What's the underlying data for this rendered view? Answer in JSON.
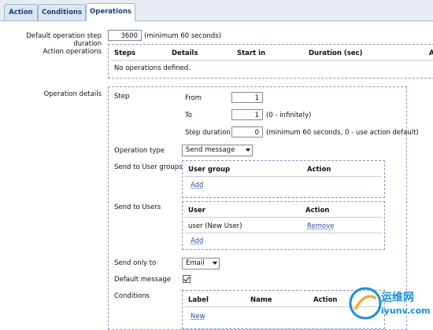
{
  "tabs": [
    {
      "label": "Action"
    },
    {
      "label": "Conditions"
    },
    {
      "label": "Operations"
    }
  ],
  "default_step": {
    "label": "Default operation step duration",
    "value": "3600",
    "hint": "(minimum 60 seconds)"
  },
  "action_operations": {
    "label": "Action operations",
    "columns": [
      "Steps",
      "Details",
      "Start in",
      "Duration (sec)",
      "A"
    ],
    "empty_text": "No operations defined."
  },
  "operation_details": {
    "label": "Operation details",
    "step": {
      "label": "Step",
      "from_label": "From",
      "from_value": "1",
      "to_label": "To",
      "to_value": "1",
      "to_hint": "(0 - infinitely)",
      "duration_label": "Step duration",
      "duration_value": "0",
      "duration_hint": "(minimum 60 seconds, 0 - use action default)"
    },
    "operation_type": {
      "label": "Operation type",
      "value": "Send message"
    },
    "user_groups": {
      "label": "Send to User groups",
      "col_group": "User group",
      "col_action": "Action",
      "add": "Add"
    },
    "users": {
      "label": "Send to Users",
      "col_user": "User",
      "col_action": "Action",
      "rows": [
        {
          "user": "user (New User)",
          "action": "Remove"
        }
      ],
      "add": "Add"
    },
    "send_only_to": {
      "label": "Send only to",
      "value": "Email"
    },
    "default_message": {
      "label": "Default message",
      "checked": true
    },
    "conditions": {
      "label": "Conditions",
      "col_label": "Label",
      "col_name": "Name",
      "col_action": "Action",
      "new": "New"
    }
  },
  "watermark": {
    "text": "运维网",
    "url": "iyunv.com",
    "colors": {
      "brand": "#1e8fd6",
      "accent": "#f5a623"
    }
  }
}
